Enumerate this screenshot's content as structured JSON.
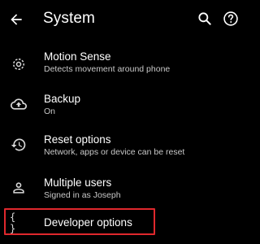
{
  "appbar": {
    "title": "System",
    "back_icon": "arrow-back-icon",
    "search_icon": "search-icon",
    "help_icon": "help-icon"
  },
  "items": [
    {
      "label": "Motion Sense",
      "sub": "Detects movement around phone",
      "icon": "motion-sense-icon"
    },
    {
      "label": "Backup",
      "sub": "On",
      "icon": "cloud-upload-icon"
    },
    {
      "label": "Reset options",
      "sub": "Network, apps or device can be reset",
      "icon": "history-icon"
    },
    {
      "label": "Multiple users",
      "sub": "Signed in as Joseph",
      "icon": "person-icon"
    },
    {
      "label": "Developer options",
      "icon": "code-braces-icon",
      "icon_text": "{ }"
    }
  ],
  "colors": {
    "background": "#000000",
    "text_primary": "#ffffff",
    "text_secondary": "#c8c8c8",
    "highlight_border": "#e0282d"
  }
}
